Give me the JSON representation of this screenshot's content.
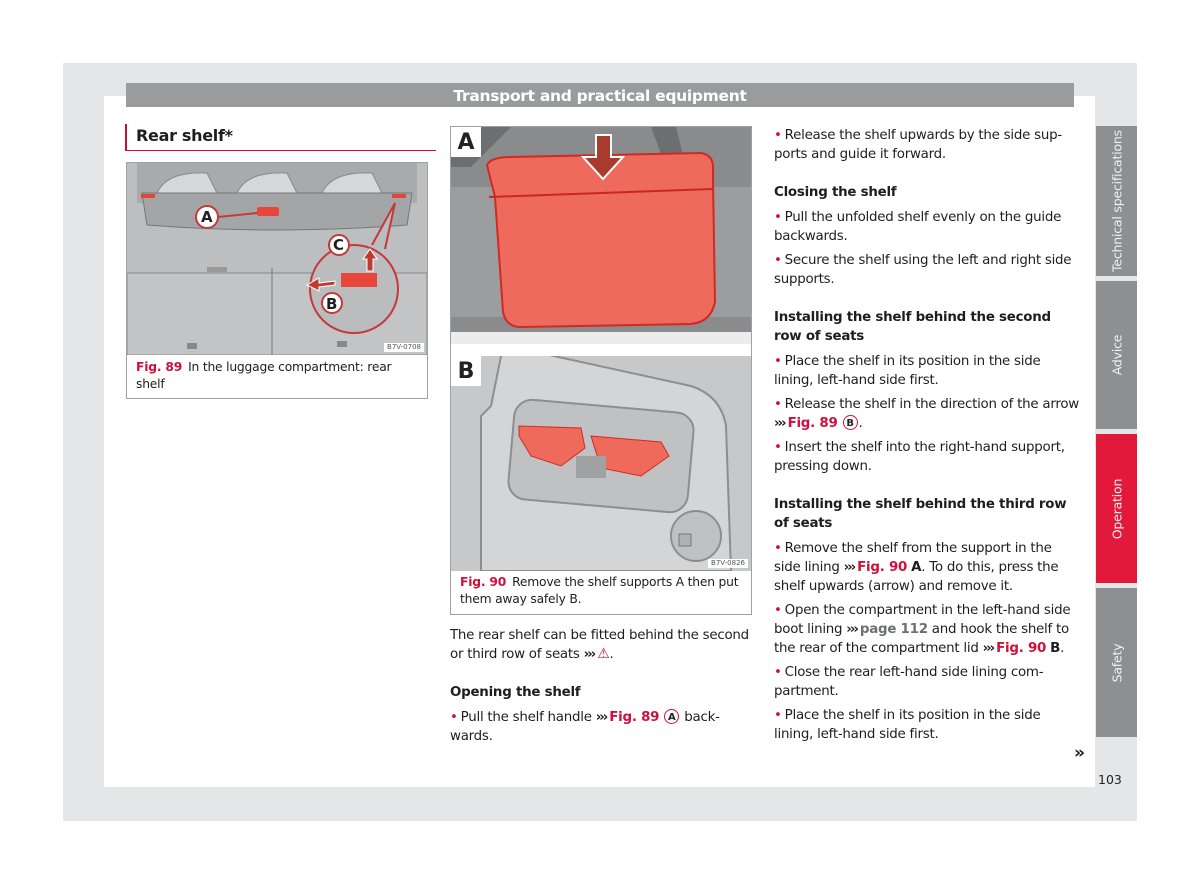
{
  "header": {
    "title": "Transport and practical equipment"
  },
  "section": {
    "title": "Rear shelf*"
  },
  "fig89": {
    "number": "Fig. 89",
    "caption": "In the luggage compartment: rear shelf",
    "code": "B7V-0708",
    "callouts": [
      "A",
      "B",
      "C"
    ]
  },
  "fig90": {
    "number": "Fig. 90",
    "caption": "Remove the shelf supports A then put them away safely B.",
    "code": "B7V-0826",
    "panels": [
      "A",
      "B"
    ]
  },
  "col2": {
    "intro": "The rear shelf can be fitted behind the sec­ond or third row of seats",
    "arrow": "›››",
    "warning_icon": "⚠",
    "opening_heading": "Opening the shelf",
    "opening_bullet_pre": "Pull the shelf handle",
    "opening_ref": "Fig. 89",
    "opening_circle": "A",
    "opening_bullet_post": "back­wards."
  },
  "col3": {
    "bullet_release": "Release the shelf upwards by the side sup­ports and guide it forward.",
    "closing_heading": "Closing the shelf",
    "closing_bullets": [
      "Pull the unfolded shelf evenly on the guide backwards.",
      "Secure the shelf using the left and right side supports."
    ],
    "second_heading": "Installing the shelf behind the second row of seats",
    "second_b1": "Place the shelf in its position in the side lining, left-hand side first.",
    "second_b2_pre": "Release the shelf in the direction of the ar­row",
    "second_b2_ref": "Fig. 89",
    "second_b2_circle": "B",
    "second_b3": "Insert the shelf into the right-hand support, pressing down.",
    "third_heading": "Installing the shelf behind the third row of seats",
    "third_b1_pre": "Remove the shelf from the support in the side lining",
    "third_b1_ref": "Fig. 90",
    "third_b1_letter": "A",
    "third_b1_post": ". To do this, press the shelf upwards (arrow) and remove it.",
    "third_b2_pre": "Open the compartment in the left-hand side boot lining",
    "third_b2_page": "page 112",
    "third_b2_mid": "and hook the shelf to the rear of the compartment lid",
    "third_b2_ref": "Fig. 90",
    "third_b2_letter": "B",
    "third_b3": "Close the rear left-hand side lining com­partment.",
    "third_b4": "Place the shelf in its position in the side lining, left-hand side first.",
    "continue": "»"
  },
  "tabs": [
    {
      "label": "Technical specifications",
      "active": false
    },
    {
      "label": "Advice",
      "active": false
    },
    {
      "label": "Operation",
      "active": true
    },
    {
      "label": "Safety",
      "active": false
    }
  ],
  "page_number": "103",
  "colors": {
    "accent": "#d0103a",
    "tab_active": "#e3193c",
    "tab_inactive": "#8e8f91",
    "header_bar": "#9a9b9d"
  }
}
